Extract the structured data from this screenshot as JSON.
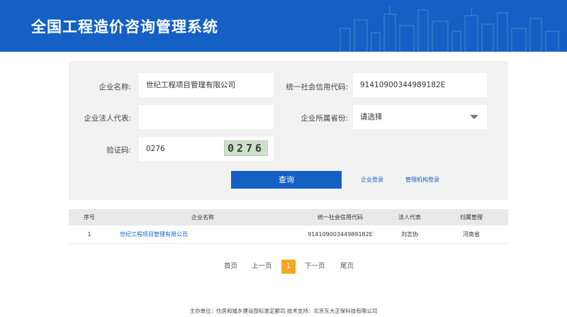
{
  "header": {
    "title": "全国工程造价咨询管理系统"
  },
  "form": {
    "company_name_label": "企业名称:",
    "company_name_value": "世纪工程项目管理有限公司",
    "credit_code_label": "统一社会信用代码:",
    "credit_code_value": "91410900344989182E",
    "legal_rep_label": "企业法人代表:",
    "legal_rep_value": "",
    "province_label": "企业所属省份:",
    "province_value": "请选择",
    "captcha_label": "验证码:",
    "captcha_value": "0276",
    "captcha_image_text": "0276"
  },
  "actions": {
    "query_label": "查询",
    "company_login_label": "企业登录",
    "agency_login_label": "管理机构登录"
  },
  "table": {
    "headers": [
      "序号",
      "企业名称",
      "统一社会信用代码",
      "法人代表",
      "归属管理"
    ],
    "rows": [
      {
        "index": "1",
        "name": "世纪工程项目管理有限公司",
        "credit_code": "91410900344989182E",
        "legal_rep": "刘志协",
        "region": "河南省"
      }
    ]
  },
  "pagination": {
    "first": "首页",
    "prev": "上一页",
    "current": "1",
    "next": "下一页",
    "last": "尾页"
  },
  "footer": {
    "text": "主办单位：住房和城乡建设部标准定额司  技术支持：北京东大正保科技有限公司"
  },
  "colors": {
    "brand": "#1460c4",
    "active_page": "#f5a623"
  }
}
